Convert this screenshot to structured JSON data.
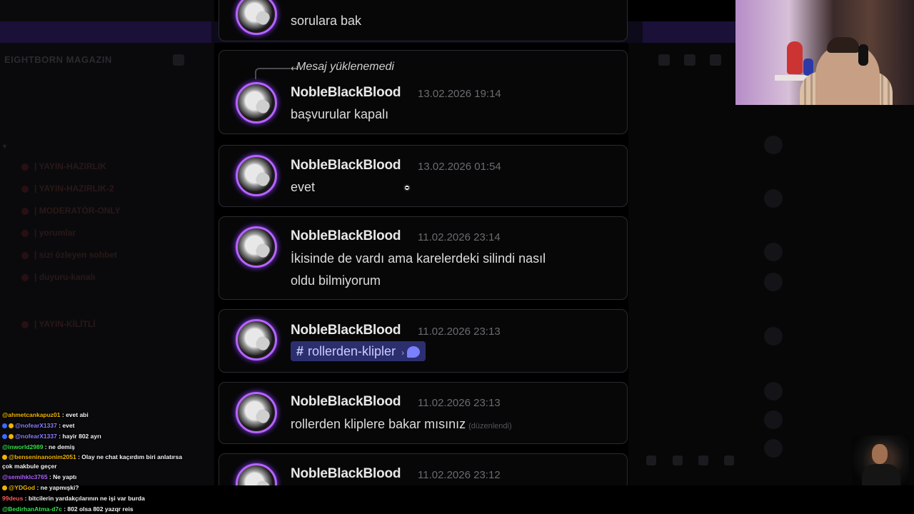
{
  "background": {
    "server_name": "EIGHTBORN MAGAZIN",
    "accent_purple": "#1b1038",
    "channels": [
      {
        "label": "| YAYIN-HAZIRLIK"
      },
      {
        "label": "| YAYIN-HAZIRLIK-2"
      },
      {
        "label": "| MODERATÖR-ONLY"
      },
      {
        "label": "| yorumlar"
      },
      {
        "label": "| sizi özleyen sohbet"
      },
      {
        "label": "| duyuru-kanalı"
      }
    ],
    "locked_channel": "| YAYIN-KİLİTLİ"
  },
  "messages": [
    {
      "author": "NobleBlackBlood",
      "time": "",
      "text": "sorulara bak"
    },
    {
      "author": "NobleBlackBlood",
      "time": "13.02.2026 19:14",
      "reply": "Mesaj yüklenemedi",
      "text": "başvurular kapalı"
    },
    {
      "author": "NobleBlackBlood",
      "time": "13.02.2026 01:54",
      "text": "evet"
    },
    {
      "author": "NobleBlackBlood",
      "time": "11.02.2026 23:14",
      "text_line1": "İkisinde de vardı ama karelerdeki silindi nasıl",
      "text_line2": "oldu bilmiyorum"
    },
    {
      "author": "NobleBlackBlood",
      "time": "11.02.2026 23:13",
      "channel_mention": "rollerden-klipler",
      "chevron": "›"
    },
    {
      "author": "NobleBlackBlood",
      "time": "11.02.2026 23:13",
      "text": "rollerden kliplere bakar mısınız",
      "edited": "(düzenlendi)"
    },
    {
      "author": "NobleBlackBlood",
      "time": "11.02.2026 23:12"
    }
  ],
  "chat": [
    {
      "user": "@ahmetcankapuz01",
      "color": "#f0b400",
      "text": " : evet abi"
    },
    {
      "user": "@nofearX1337",
      "color": "#8a7dff",
      "text": " : evet"
    },
    {
      "user": "@nofearX1337",
      "color": "#8a7dff",
      "text": " : hayir 802 ayrı"
    },
    {
      "user": "@inworld2989",
      "color": "#35e04a",
      "text": " : ne demiş"
    },
    {
      "user": "@benseninanonim2051",
      "color": "#f0b400",
      "text": " : Olay ne chat kaçırdım biri anlatırsa çok makbule geçer"
    },
    {
      "user": "@semihklc3765",
      "color": "#b260ff",
      "text": " : Ne yaptı"
    },
    {
      "user": "@YDGod",
      "color": "#f0b400",
      "text": " : ne yapmışki?"
    },
    {
      "user": "99deus",
      "color": "#ff5a5a",
      "text": " : bitcilerin yardakçılarının ne işi var burda"
    },
    {
      "user": "@BedirhanAtma-d7c",
      "color": "#35e04a",
      "text": " : 802 olsa 802 yazqr reis"
    }
  ]
}
